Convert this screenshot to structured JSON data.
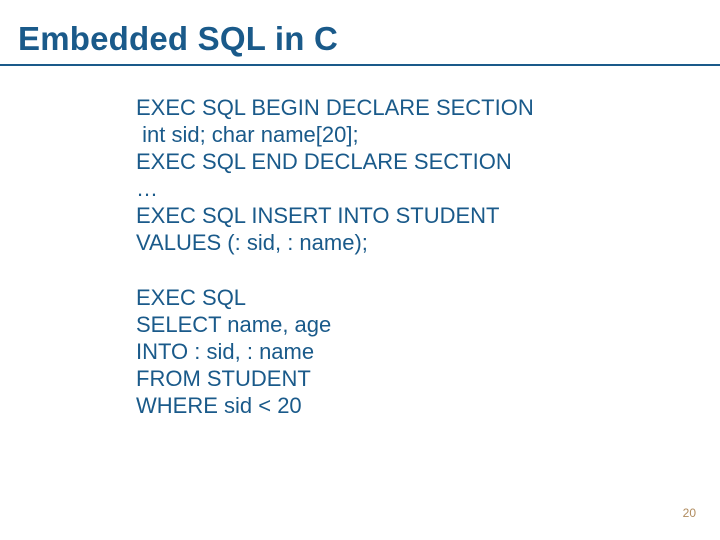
{
  "title": "Embedded SQL in C",
  "code1": {
    "l1": "EXEC SQL BEGIN DECLARE SECTION",
    "l2": " int sid;  char name[20];",
    "l3": "EXEC SQL END DECLARE SECTION",
    "l4": "…",
    "l5": "EXEC SQL INSERT INTO STUDENT",
    "l6": "VALUES (: sid, : name);"
  },
  "code2": {
    "l1": "EXEC SQL",
    "l2": "SELECT name, age",
    "l3": "INTO : sid, : name",
    "l4": "FROM STUDENT",
    "l5": "WHERE sid < 20"
  },
  "page_number": "20"
}
